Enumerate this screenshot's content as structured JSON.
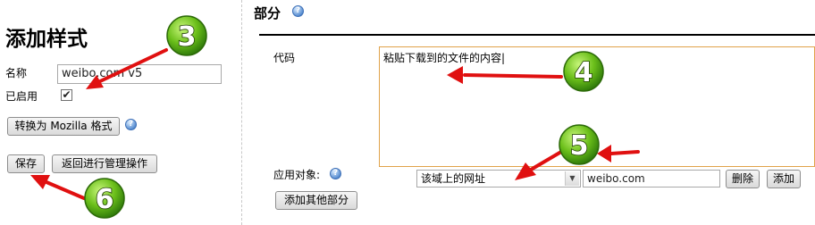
{
  "left": {
    "title": "添加样式",
    "name_label": "名称",
    "name_value": "weibo.com v5",
    "enabled_label": "已启用",
    "enabled_checked": "✔",
    "convert_button": "转换为 Mozilla 格式",
    "save_button": "保存",
    "back_button": "返回进行管理操作"
  },
  "right": {
    "section_title": "部分",
    "code_label": "代码",
    "code_value": "粘贴下载到的文件的内容|",
    "apply_label": "应用对象:",
    "apply_select": "该域上的网址",
    "apply_value": "weibo.com",
    "delete_button": "删除",
    "add_button": "添加",
    "add_section_button": "添加其他部分"
  },
  "markers": [
    "3",
    "4",
    "5",
    "6"
  ],
  "icons": {
    "help": "help-icon",
    "dropdown": "chevron-down-icon"
  },
  "colors": {
    "arrow": "#e01010",
    "marker_fill": "#6bbf1a",
    "textarea_border": "#e0a24a"
  }
}
